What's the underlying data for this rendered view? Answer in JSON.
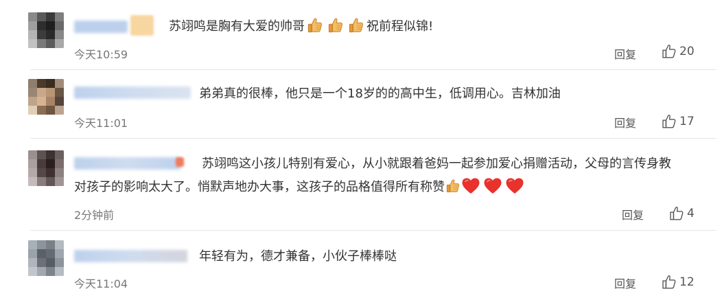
{
  "comments": [
    {
      "text_before": "苏翊鸣是胸有大爱的帅哥",
      "text_after": "祝前程似锦!",
      "time": "今天10:59",
      "reply": "回复",
      "likes": "20"
    },
    {
      "text": "弟弟真的很棒，他只是一个18岁的的高中生，低调用心。吉林加油",
      "time": "今天11:01",
      "reply": "回复",
      "likes": "17"
    },
    {
      "line1": "苏翊鸣这小孩儿特别有爱心，从小就跟着爸妈一起参加爱心捐赠活动，父母的言传身教",
      "line2": "对孩子的影响太大了。悄默声地办大事，这孩子的品格值得所有称赞",
      "time": "2分钟前",
      "reply": "回复",
      "likes": "4"
    },
    {
      "text": "年轻有为，德才兼备，小伙子棒棒哒",
      "time": "今天11:04",
      "reply": "回复",
      "likes": "12"
    }
  ],
  "colors": {
    "text": "#333333",
    "meta": "#777777",
    "heart": "#e8322b",
    "thumb": "#f2b55a"
  },
  "icons": {
    "thumb": "thumbs-up-icon",
    "heart": "heart-icon",
    "like": "like-outline-icon"
  }
}
